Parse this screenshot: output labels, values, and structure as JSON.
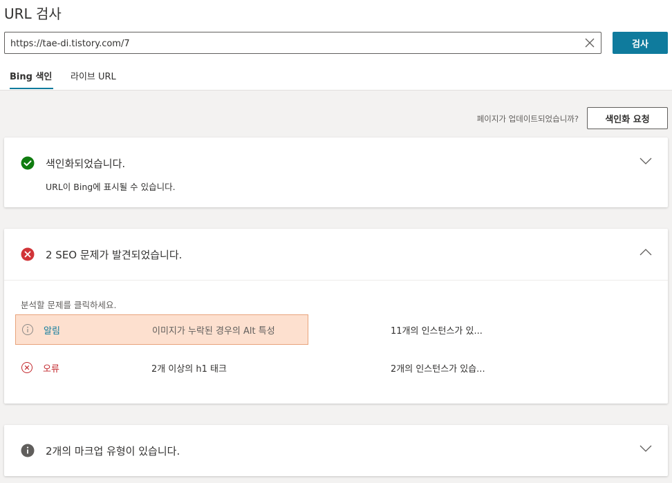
{
  "page": {
    "title": "URL 검사"
  },
  "search": {
    "value": "https://tae-di.tistory.com/7",
    "button_label": "검사"
  },
  "tabs": [
    {
      "label": "Bing 색인",
      "active": true
    },
    {
      "label": "라이브 URL",
      "active": false
    }
  ],
  "request": {
    "question": "페이지가 업데이트되었습니까?",
    "button_label": "색인화 요청"
  },
  "indexed_card": {
    "title": "색인화되었습니다.",
    "subtitle": "URL이 Bing에 표시될 수 있습니다.",
    "status_color": "#107c10"
  },
  "seo_card": {
    "title": "2 SEO 문제가 발견되었습니다.",
    "status_color": "#d13438",
    "hint": "분석할 문제를 클릭하세요.",
    "issues": [
      {
        "severity": "알림",
        "description": "이미지가 누락된 경우의 Alt 특성",
        "instances": "11개의 인스턴스가 있...",
        "icon": "info-circle-icon"
      },
      {
        "severity": "오류",
        "description": "2개 이상의 h1 태크",
        "instances": "2개의 인스턴스가 있습...",
        "icon": "error-circle-icon"
      }
    ]
  },
  "markup_card": {
    "title": "2개의 마크업 유형이 있습니다.",
    "status_color": "#605e5c"
  },
  "colors": {
    "accent": "#0f7b9d",
    "alert_bg": "#fde0cf",
    "alert_border": "#e8a37b",
    "error": "#c2262b"
  }
}
